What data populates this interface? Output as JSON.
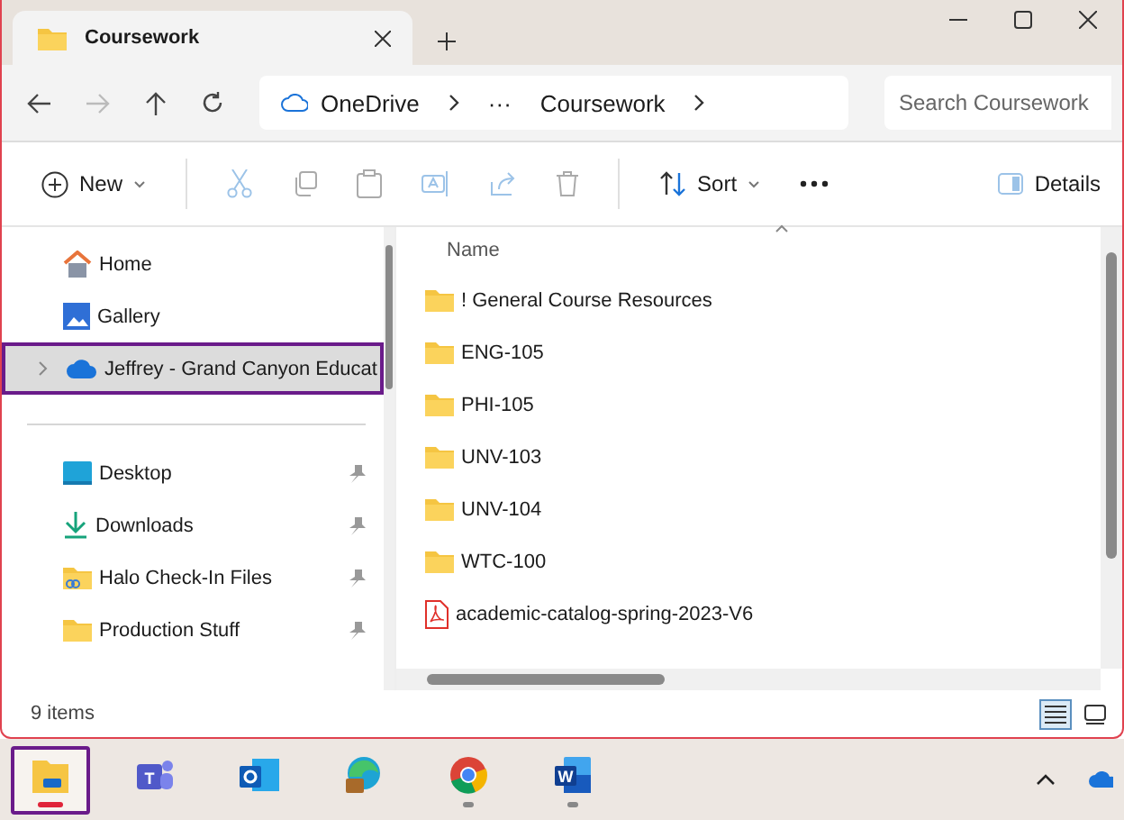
{
  "window": {
    "tab_title": "Coursework"
  },
  "address": {
    "crumbs": [
      "OneDrive",
      "···",
      "Coursework"
    ],
    "search_placeholder": "Search Coursework"
  },
  "toolbar": {
    "new_label": "New",
    "sort_label": "Sort",
    "details_label": "Details"
  },
  "nav": {
    "top": [
      {
        "label": "Home",
        "kind": "home",
        "selected": false
      },
      {
        "label": "Gallery",
        "kind": "gallery",
        "selected": false
      },
      {
        "label": "Jeffrey - Grand Canyon Educat",
        "kind": "cloud",
        "selected": true
      }
    ],
    "pinned": [
      {
        "label": "Desktop",
        "kind": "desktop"
      },
      {
        "label": "Downloads",
        "kind": "download"
      },
      {
        "label": "Halo Check-In Files",
        "kind": "shared"
      },
      {
        "label": "Production Stuff",
        "kind": "folder"
      }
    ]
  },
  "files": {
    "column": "Name",
    "items": [
      {
        "name": "! General Course Resources",
        "kind": "folder"
      },
      {
        "name": "ENG-105",
        "kind": "folder"
      },
      {
        "name": "PHI-105",
        "kind": "folder"
      },
      {
        "name": "UNV-103",
        "kind": "folder"
      },
      {
        "name": "UNV-104",
        "kind": "folder"
      },
      {
        "name": "WTC-100",
        "kind": "folder"
      },
      {
        "name": "academic-catalog-spring-2023-V6",
        "kind": "pdf"
      }
    ]
  },
  "status_bar": {
    "count": "9 items",
    "views": [
      {
        "kind": "details",
        "selected": true
      },
      {
        "kind": "tiles",
        "selected": false
      }
    ]
  },
  "taskbar": {
    "apps": [
      {
        "kind": "explorer",
        "selected": true,
        "running": true
      },
      {
        "kind": "teams",
        "selected": false,
        "running": false,
        "letter": "T"
      },
      {
        "kind": "outlook",
        "selected": false,
        "running": false
      },
      {
        "kind": "edge",
        "selected": false,
        "running": false
      },
      {
        "kind": "chrome",
        "selected": false,
        "running": true
      },
      {
        "kind": "word",
        "selected": false,
        "running": true,
        "letter": "W"
      }
    ]
  }
}
